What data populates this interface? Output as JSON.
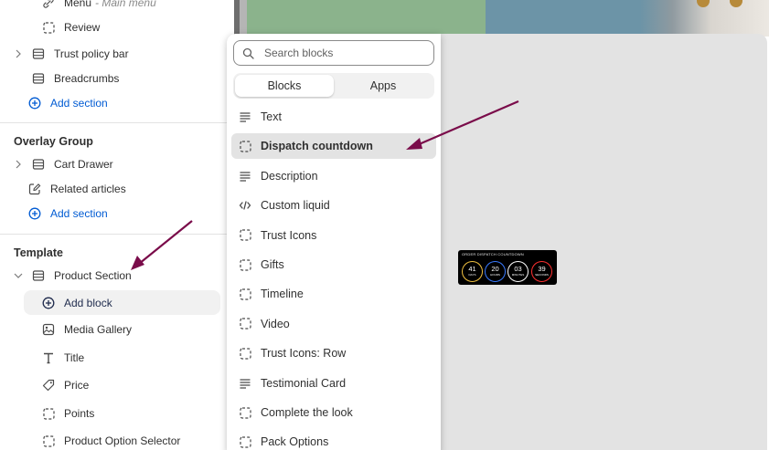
{
  "sidebar": {
    "rows_top": [
      {
        "label": "Menu",
        "sublabel": "Main menu",
        "icon": "link-icon"
      },
      {
        "label": "Review",
        "icon": "dashed-square-icon"
      },
      {
        "label": "Trust policy bar",
        "icon": "section-icon"
      },
      {
        "label": "Breadcrumbs",
        "icon": "section-icon"
      },
      {
        "label": "Add section",
        "icon": "plus-circle-icon"
      }
    ],
    "overlay_group": {
      "title": "Overlay Group",
      "items": [
        {
          "label": "Cart Drawer",
          "icon": "section-icon"
        },
        {
          "label": "Related articles",
          "icon": "edit-icon"
        },
        {
          "label": "Add section",
          "icon": "plus-circle-icon"
        }
      ]
    },
    "template": {
      "title": "Template",
      "section_label": "Product Section",
      "items": [
        {
          "label": "Add block",
          "icon": "plus-circle-icon"
        },
        {
          "label": "Media Gallery",
          "icon": "image-icon"
        },
        {
          "label": "Title",
          "icon": "text-t-icon"
        },
        {
          "label": "Price",
          "icon": "price-tag-icon"
        },
        {
          "label": "Points",
          "icon": "dashed-square-icon"
        },
        {
          "label": "Product Option Selector",
          "icon": "dashed-square-icon"
        }
      ]
    }
  },
  "popover": {
    "search_placeholder": "Search blocks",
    "tabs": [
      {
        "label": "Blocks",
        "active": true
      },
      {
        "label": "Apps",
        "active": false
      }
    ],
    "blocks": [
      {
        "label": "Text",
        "icon": "text-lines-icon"
      },
      {
        "label": "Dispatch countdown",
        "icon": "dashed-square-icon",
        "highlighted": true
      },
      {
        "label": "Description",
        "icon": "text-lines-icon"
      },
      {
        "label": "Custom liquid",
        "icon": "code-icon"
      },
      {
        "label": "Trust Icons",
        "icon": "dashed-square-icon"
      },
      {
        "label": "Gifts",
        "icon": "dashed-square-icon"
      },
      {
        "label": "Timeline",
        "icon": "dashed-square-icon"
      },
      {
        "label": "Video",
        "icon": "dashed-square-icon"
      },
      {
        "label": "Trust Icons: Row",
        "icon": "dashed-square-icon"
      },
      {
        "label": "Testimonial Card",
        "icon": "text-lines-icon"
      },
      {
        "label": "Complete the look",
        "icon": "dashed-square-icon"
      },
      {
        "label": "Pack Options",
        "icon": "dashed-square-icon"
      }
    ]
  },
  "preview": {
    "countdown": {
      "title": "ORDER DISPATCH COUNTDOWN",
      "units": [
        {
          "value": "41",
          "unit": "DAYS",
          "color": "#f0c040"
        },
        {
          "value": "20",
          "unit": "HOURS",
          "color": "#3a7bff"
        },
        {
          "value": "03",
          "unit": "MINUTES",
          "color": "#ffffff"
        },
        {
          "value": "39",
          "unit": "SECONDS",
          "color": "#ff3030"
        }
      ]
    }
  },
  "annotation_color": "#7a0c4a"
}
